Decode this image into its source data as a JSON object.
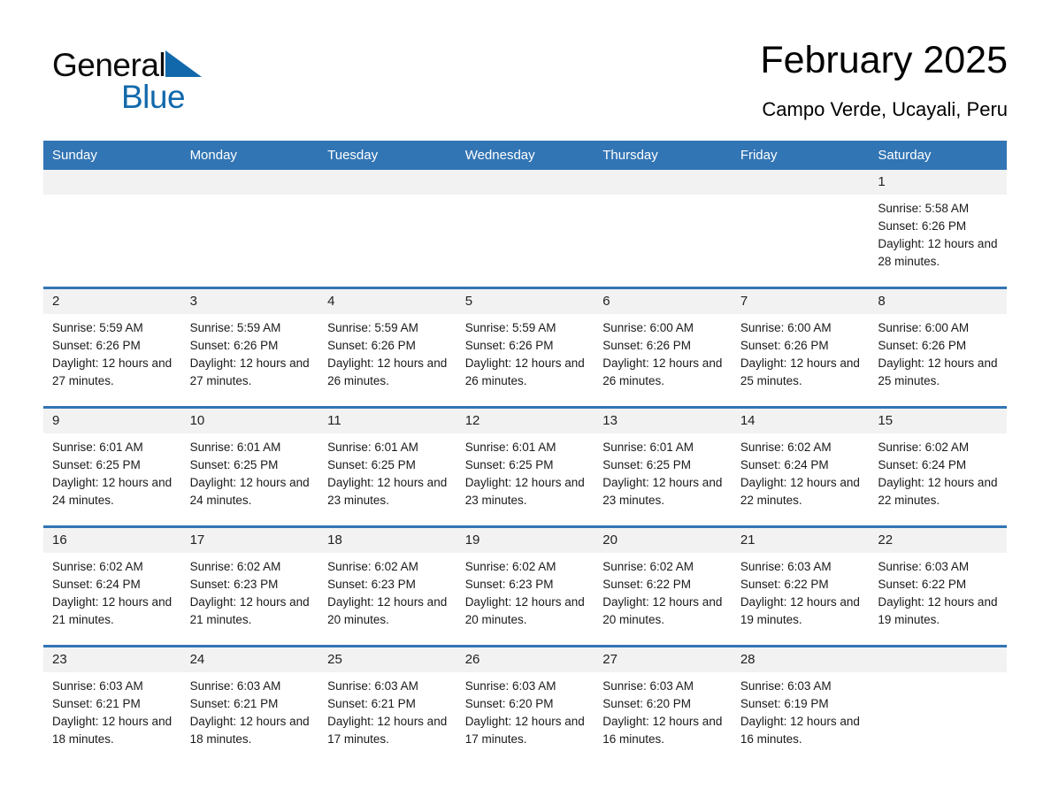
{
  "brand": {
    "word_one": "General",
    "word_two": "Blue",
    "accent_color": "#1169ab"
  },
  "header": {
    "title": "February 2025",
    "subtitle": "Campo Verde, Ucayali, Peru"
  },
  "theme": {
    "header_blue": "#3275b4",
    "daynum_background": "#f2f2f2",
    "row_rule": "#3275b4"
  },
  "weekdays": [
    "Sunday",
    "Monday",
    "Tuesday",
    "Wednesday",
    "Thursday",
    "Friday",
    "Saturday"
  ],
  "weeks": [
    [
      {
        "day": "",
        "sunrise": "",
        "sunset": "",
        "daylight": "",
        "blank": true
      },
      {
        "day": "",
        "sunrise": "",
        "sunset": "",
        "daylight": "",
        "blank": true
      },
      {
        "day": "",
        "sunrise": "",
        "sunset": "",
        "daylight": "",
        "blank": true
      },
      {
        "day": "",
        "sunrise": "",
        "sunset": "",
        "daylight": "",
        "blank": true
      },
      {
        "day": "",
        "sunrise": "",
        "sunset": "",
        "daylight": "",
        "blank": true
      },
      {
        "day": "",
        "sunrise": "",
        "sunset": "",
        "daylight": "",
        "blank": true
      },
      {
        "day": "1",
        "sunrise": "Sunrise: 5:58 AM",
        "sunset": "Sunset: 6:26 PM",
        "daylight": "Daylight: 12 hours and 28 minutes.",
        "blank": false
      }
    ],
    [
      {
        "day": "2",
        "sunrise": "Sunrise: 5:59 AM",
        "sunset": "Sunset: 6:26 PM",
        "daylight": "Daylight: 12 hours and 27 minutes.",
        "blank": false
      },
      {
        "day": "3",
        "sunrise": "Sunrise: 5:59 AM",
        "sunset": "Sunset: 6:26 PM",
        "daylight": "Daylight: 12 hours and 27 minutes.",
        "blank": false
      },
      {
        "day": "4",
        "sunrise": "Sunrise: 5:59 AM",
        "sunset": "Sunset: 6:26 PM",
        "daylight": "Daylight: 12 hours and 26 minutes.",
        "blank": false
      },
      {
        "day": "5",
        "sunrise": "Sunrise: 5:59 AM",
        "sunset": "Sunset: 6:26 PM",
        "daylight": "Daylight: 12 hours and 26 minutes.",
        "blank": false
      },
      {
        "day": "6",
        "sunrise": "Sunrise: 6:00 AM",
        "sunset": "Sunset: 6:26 PM",
        "daylight": "Daylight: 12 hours and 26 minutes.",
        "blank": false
      },
      {
        "day": "7",
        "sunrise": "Sunrise: 6:00 AM",
        "sunset": "Sunset: 6:26 PM",
        "daylight": "Daylight: 12 hours and 25 minutes.",
        "blank": false
      },
      {
        "day": "8",
        "sunrise": "Sunrise: 6:00 AM",
        "sunset": "Sunset: 6:26 PM",
        "daylight": "Daylight: 12 hours and 25 minutes.",
        "blank": false
      }
    ],
    [
      {
        "day": "9",
        "sunrise": "Sunrise: 6:01 AM",
        "sunset": "Sunset: 6:25 PM",
        "daylight": "Daylight: 12 hours and 24 minutes.",
        "blank": false
      },
      {
        "day": "10",
        "sunrise": "Sunrise: 6:01 AM",
        "sunset": "Sunset: 6:25 PM",
        "daylight": "Daylight: 12 hours and 24 minutes.",
        "blank": false
      },
      {
        "day": "11",
        "sunrise": "Sunrise: 6:01 AM",
        "sunset": "Sunset: 6:25 PM",
        "daylight": "Daylight: 12 hours and 23 minutes.",
        "blank": false
      },
      {
        "day": "12",
        "sunrise": "Sunrise: 6:01 AM",
        "sunset": "Sunset: 6:25 PM",
        "daylight": "Daylight: 12 hours and 23 minutes.",
        "blank": false
      },
      {
        "day": "13",
        "sunrise": "Sunrise: 6:01 AM",
        "sunset": "Sunset: 6:25 PM",
        "daylight": "Daylight: 12 hours and 23 minutes.",
        "blank": false
      },
      {
        "day": "14",
        "sunrise": "Sunrise: 6:02 AM",
        "sunset": "Sunset: 6:24 PM",
        "daylight": "Daylight: 12 hours and 22 minutes.",
        "blank": false
      },
      {
        "day": "15",
        "sunrise": "Sunrise: 6:02 AM",
        "sunset": "Sunset: 6:24 PM",
        "daylight": "Daylight: 12 hours and 22 minutes.",
        "blank": false
      }
    ],
    [
      {
        "day": "16",
        "sunrise": "Sunrise: 6:02 AM",
        "sunset": "Sunset: 6:24 PM",
        "daylight": "Daylight: 12 hours and 21 minutes.",
        "blank": false
      },
      {
        "day": "17",
        "sunrise": "Sunrise: 6:02 AM",
        "sunset": "Sunset: 6:23 PM",
        "daylight": "Daylight: 12 hours and 21 minutes.",
        "blank": false
      },
      {
        "day": "18",
        "sunrise": "Sunrise: 6:02 AM",
        "sunset": "Sunset: 6:23 PM",
        "daylight": "Daylight: 12 hours and 20 minutes.",
        "blank": false
      },
      {
        "day": "19",
        "sunrise": "Sunrise: 6:02 AM",
        "sunset": "Sunset: 6:23 PM",
        "daylight": "Daylight: 12 hours and 20 minutes.",
        "blank": false
      },
      {
        "day": "20",
        "sunrise": "Sunrise: 6:02 AM",
        "sunset": "Sunset: 6:22 PM",
        "daylight": "Daylight: 12 hours and 20 minutes.",
        "blank": false
      },
      {
        "day": "21",
        "sunrise": "Sunrise: 6:03 AM",
        "sunset": "Sunset: 6:22 PM",
        "daylight": "Daylight: 12 hours and 19 minutes.",
        "blank": false
      },
      {
        "day": "22",
        "sunrise": "Sunrise: 6:03 AM",
        "sunset": "Sunset: 6:22 PM",
        "daylight": "Daylight: 12 hours and 19 minutes.",
        "blank": false
      }
    ],
    [
      {
        "day": "23",
        "sunrise": "Sunrise: 6:03 AM",
        "sunset": "Sunset: 6:21 PM",
        "daylight": "Daylight: 12 hours and 18 minutes.",
        "blank": false
      },
      {
        "day": "24",
        "sunrise": "Sunrise: 6:03 AM",
        "sunset": "Sunset: 6:21 PM",
        "daylight": "Daylight: 12 hours and 18 minutes.",
        "blank": false
      },
      {
        "day": "25",
        "sunrise": "Sunrise: 6:03 AM",
        "sunset": "Sunset: 6:21 PM",
        "daylight": "Daylight: 12 hours and 17 minutes.",
        "blank": false
      },
      {
        "day": "26",
        "sunrise": "Sunrise: 6:03 AM",
        "sunset": "Sunset: 6:20 PM",
        "daylight": "Daylight: 12 hours and 17 minutes.",
        "blank": false
      },
      {
        "day": "27",
        "sunrise": "Sunrise: 6:03 AM",
        "sunset": "Sunset: 6:20 PM",
        "daylight": "Daylight: 12 hours and 16 minutes.",
        "blank": false
      },
      {
        "day": "28",
        "sunrise": "Sunrise: 6:03 AM",
        "sunset": "Sunset: 6:19 PM",
        "daylight": "Daylight: 12 hours and 16 minutes.",
        "blank": false
      },
      {
        "day": "",
        "sunrise": "",
        "sunset": "",
        "daylight": "",
        "blank": true
      }
    ]
  ]
}
